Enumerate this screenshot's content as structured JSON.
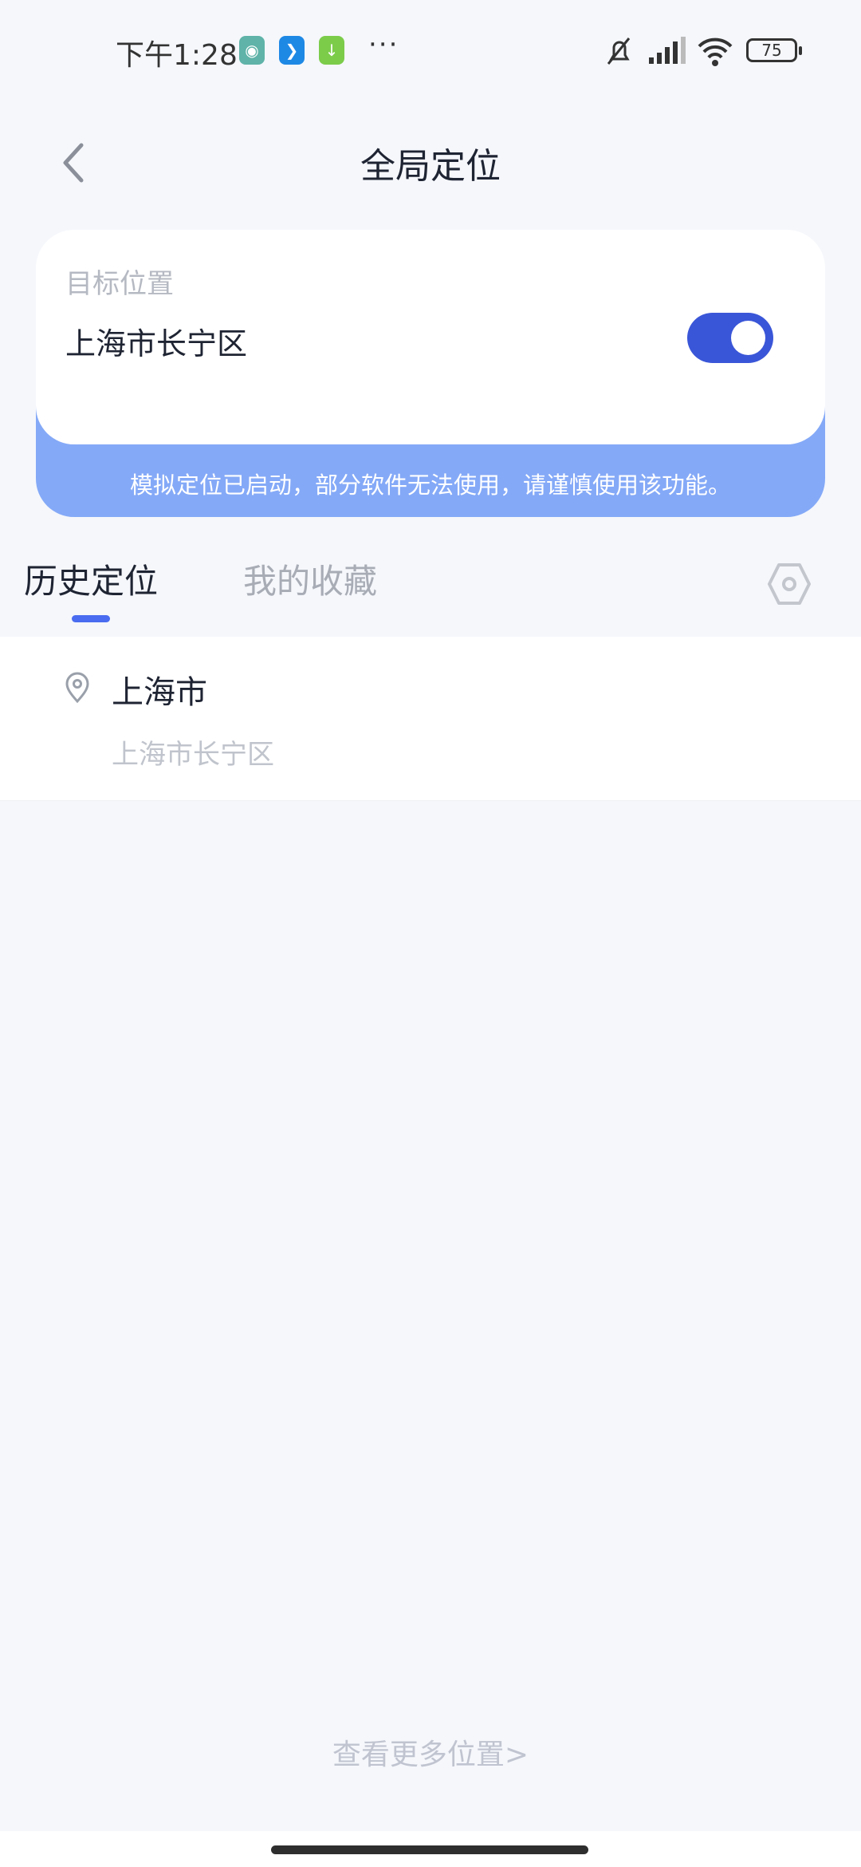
{
  "status_bar": {
    "time": "下午1:28",
    "battery": "75",
    "more": "···",
    "notification_icons": [
      "location-app-icon",
      "feather-app-icon",
      "download-app-icon"
    ],
    "system_icons": [
      "bell-muted-icon",
      "signal-icon",
      "wifi-icon",
      "battery-icon"
    ]
  },
  "header": {
    "title": "全局定位"
  },
  "card": {
    "label": "目标位置",
    "value": "上海市长宁区",
    "toggle_on": true,
    "warning": "模拟定位已启动，部分软件无法使用，请谨慎使用该功能。"
  },
  "tabs": [
    {
      "label": "历史定位",
      "active": true
    },
    {
      "label": "我的收藏",
      "active": false
    }
  ],
  "history": [
    {
      "title": "上海市",
      "subtitle": "上海市长宁区"
    }
  ],
  "more_link": "查看更多位置>",
  "colors": {
    "accent": "#3a56d8",
    "banner": "#84a9f7",
    "background": "#f5f7fb"
  }
}
